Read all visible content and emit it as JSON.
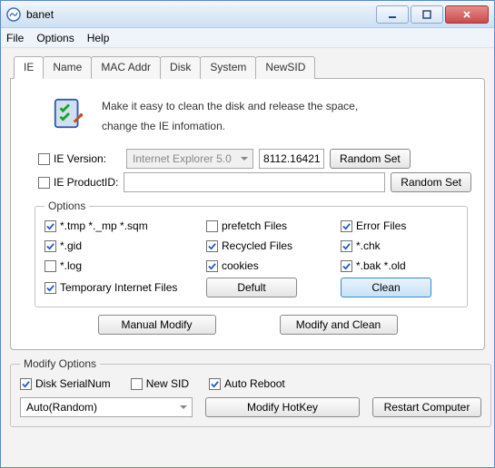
{
  "window": {
    "title": "banet"
  },
  "menu": {
    "file": "File",
    "options": "Options",
    "help": "Help"
  },
  "tabs": {
    "ie": "IE",
    "name": "Name",
    "mac": "MAC Addr",
    "disk": "Disk",
    "system": "System",
    "newsid": "NewSID"
  },
  "intro": {
    "line1": "Make it easy to clean the disk and release the space,",
    "line2": "change the IE infomation."
  },
  "ie": {
    "version_label": "IE Version:",
    "version_value": "Internet Explorer 5.0",
    "version_build": "8112.16421",
    "random_set": "Random Set",
    "productid_label": "IE ProductID:",
    "productid_value": ""
  },
  "options": {
    "legend": "Options",
    "tmp": "*.tmp  *._mp  *.sqm",
    "prefetch": "prefetch Files",
    "error": "Error Files",
    "gid": "*.gid",
    "recycled": "Recycled Files",
    "chk": "*.chk",
    "log": "*.log",
    "cookies": "cookies",
    "bak": "*.bak  *.old",
    "tempinet": "Temporary Internet Files",
    "default_btn": "Defult",
    "clean_btn": "Clean"
  },
  "mid": {
    "manual_modify": "Manual Modify",
    "modify_and_clean": "Modify and Clean"
  },
  "modify": {
    "legend": "Modify Options",
    "disk_serial": "Disk SerialNum",
    "new_sid": "New SID",
    "auto_reboot": "Auto Reboot",
    "mode_select": "Auto(Random)",
    "modify_hotkey": "Modify HotKey",
    "restart": "Restart Computer"
  }
}
